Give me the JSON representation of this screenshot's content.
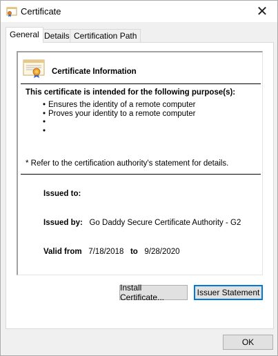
{
  "window": {
    "title": "Certificate",
    "close_glyph": "✕"
  },
  "tabs": [
    {
      "label": "General",
      "active": true
    },
    {
      "label": "Details",
      "active": false
    },
    {
      "label": "Certification Path",
      "active": false
    }
  ],
  "info": {
    "heading": "Certificate Information",
    "purpose_heading": "This certificate is intended for the following purpose(s):",
    "purposes": [
      "Ensures the identity of a remote computer",
      "Proves your identity to a remote computer",
      "",
      ""
    ],
    "footnote": "* Refer to the certification authority's statement for details.",
    "issued_to_label": "Issued to:",
    "issued_to_value": "",
    "issued_by_label": "Issued by:",
    "issued_by_value": "Go Daddy Secure Certificate Authority - G2",
    "valid_from_label": "Valid from",
    "valid_from_value": "7/18/2018",
    "valid_to_label": "to",
    "valid_to_value": "9/28/2020"
  },
  "buttons": {
    "install": "Install Certificate...",
    "issuer": "Issuer Statement",
    "ok": "OK"
  },
  "icons": {
    "title": "certificate-icon",
    "info": "certificate-large-icon"
  }
}
